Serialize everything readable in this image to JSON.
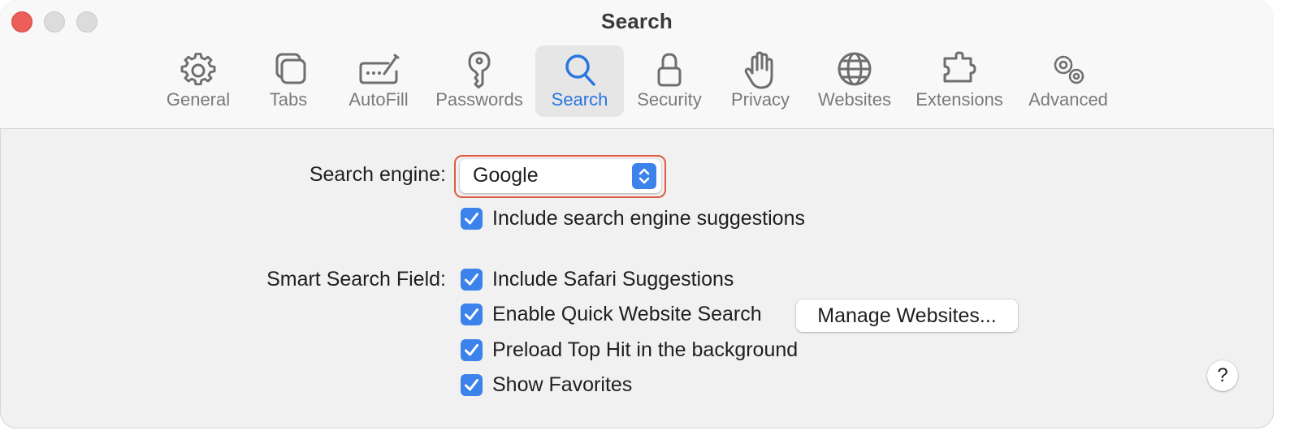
{
  "window": {
    "title": "Search"
  },
  "toolbar": {
    "tabs": [
      {
        "label": "General",
        "icon": "gear-icon"
      },
      {
        "label": "Tabs",
        "icon": "tabs-icon"
      },
      {
        "label": "AutoFill",
        "icon": "autofill-icon"
      },
      {
        "label": "Passwords",
        "icon": "key-icon"
      },
      {
        "label": "Search",
        "icon": "magnifier-icon",
        "selected": true
      },
      {
        "label": "Security",
        "icon": "lock-icon"
      },
      {
        "label": "Privacy",
        "icon": "hand-icon"
      },
      {
        "label": "Websites",
        "icon": "globe-icon"
      },
      {
        "label": "Extensions",
        "icon": "puzzle-icon"
      },
      {
        "label": "Advanced",
        "icon": "gears-icon"
      }
    ]
  },
  "search": {
    "engine_label": "Search engine:",
    "engine_value": "Google",
    "suggestions_label": "Include search engine suggestions",
    "suggestions_checked": true
  },
  "smart_field": {
    "label": "Smart Search Field:",
    "options": [
      {
        "label": "Include Safari Suggestions",
        "checked": true
      },
      {
        "label": "Enable Quick Website Search",
        "checked": true
      },
      {
        "label": "Preload Top Hit in the background",
        "checked": true
      },
      {
        "label": "Show Favorites",
        "checked": true
      }
    ],
    "manage_button": "Manage Websites..."
  },
  "help_button": "?",
  "colors": {
    "accent": "#3b82ea",
    "selected_tab_text": "#2a75e0",
    "focus_ring": "#e05a3f"
  }
}
